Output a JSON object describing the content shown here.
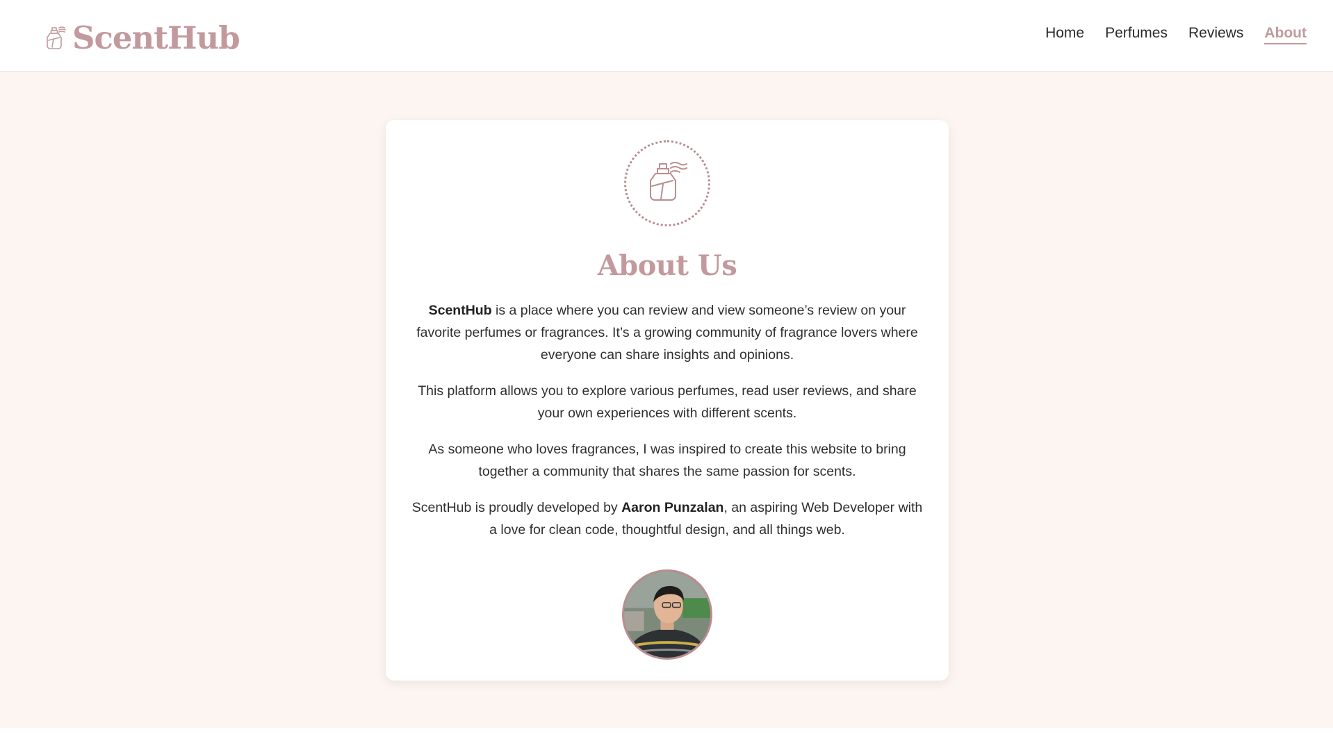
{
  "brand": {
    "name": "ScentHub",
    "icon": "perfume-bottle-icon",
    "color": "#c29a9d"
  },
  "nav": [
    {
      "label": "Home",
      "active": false
    },
    {
      "label": "Perfumes",
      "active": false
    },
    {
      "label": "Reviews",
      "active": false
    },
    {
      "label": "About",
      "active": true
    }
  ],
  "about": {
    "title": "About Us",
    "p1_bold": "ScentHub",
    "p1_rest": " is a place where you can review and view someone’s review on your favorite perfumes or fragrances. It’s a growing community of fragrance lovers where everyone can share insights and opinions.",
    "p2": "This platform allows you to explore various perfumes, read user reviews, and share your own experiences with different scents.",
    "p3": "As someone who loves fragrances, I was inspired to create this website to bring together a community that shares the same passion for scents.",
    "p4_start": "ScentHub is proudly developed by ",
    "p4_bold": "Aaron Punzalan",
    "p4_end": ", an aspiring Web Developer with a love for clean code, thoughtful design, and all things web."
  },
  "colors": {
    "background": "#fcf5f1",
    "accent": "#c29a9d",
    "text": "#2b2b2b"
  }
}
